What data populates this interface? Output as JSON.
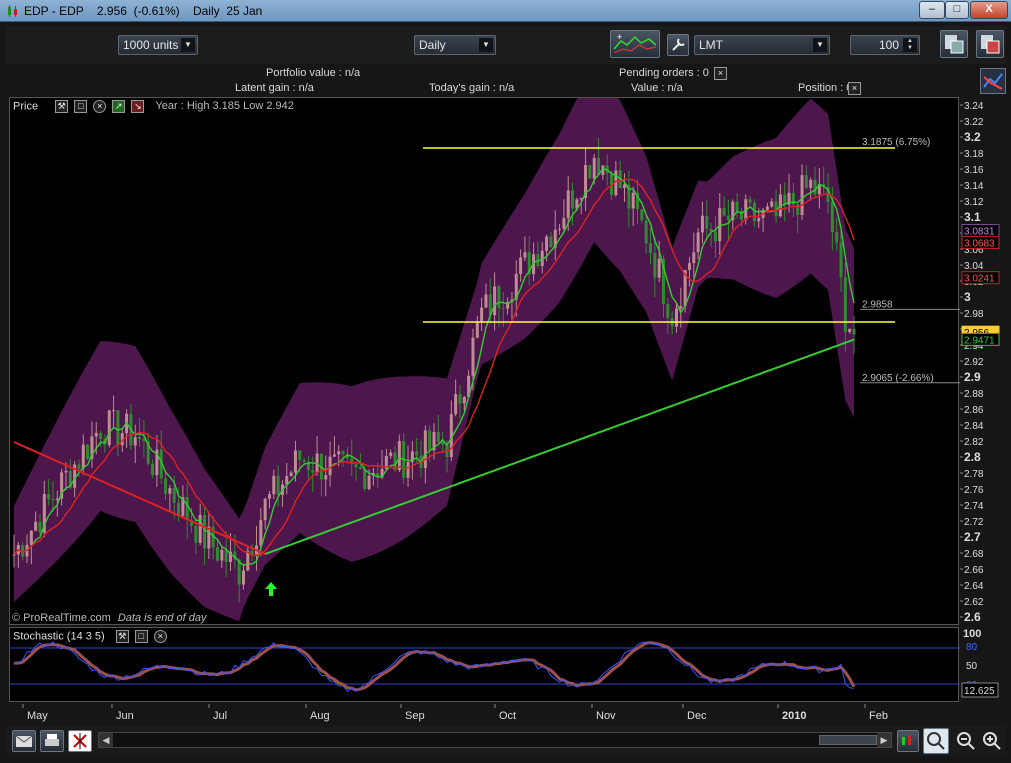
{
  "window": {
    "title": "EDP - EDP    2.956  (-0.61%)    Daily  25 Jan",
    "minimize": "–",
    "maximize": "□",
    "close": "X"
  },
  "toolbar": {
    "units_value": "1000 units",
    "timeframe_value": "Daily",
    "order_type_value": "LMT",
    "quantity_value": "100"
  },
  "info": {
    "portfolio_value": "Portfolio value : n/a",
    "pending_orders": "Pending orders : 0",
    "latent_gain": "Latent gain : n/a",
    "todays_gain": "Today's gain : n/a",
    "value": "Value : n/a",
    "position": "Position : 0"
  },
  "price_panel": {
    "label": "Price",
    "year_range": "Year : High 3.185  Low 2.942",
    "watermark": "© ProRealTime.com",
    "data_note": "Data is end of day",
    "level_upper": "3.1875 (6.75%)",
    "level_mid": "2.9858",
    "level_lower": "2.9065 (-2.66%)",
    "colors": {
      "band": "#5a1a5a",
      "yellow_line": "#ffff33",
      "ma_green": "#33cc33",
      "ma_red": "#dd2222",
      "candle_up": "#c08c94",
      "candle_down": "#2e8b2e"
    }
  },
  "price_axis": {
    "ticks": [
      "3.24",
      "3.22",
      "3.2",
      "3.18",
      "3.16",
      "3.14",
      "3.12",
      "3.1",
      "3.08",
      "3.06",
      "3.04",
      "3.02",
      "3",
      "2.98",
      "2.96",
      "2.94",
      "2.92",
      "2.9",
      "2.88",
      "2.86",
      "2.84",
      "2.82",
      "2.8",
      "2.78",
      "2.76",
      "2.74",
      "2.72",
      "2.7",
      "2.68",
      "2.66",
      "2.64",
      "2.62",
      "2.6"
    ],
    "major": [
      "3.2",
      "3.1",
      "3",
      "2.9",
      "2.8",
      "2.7",
      "2.6"
    ],
    "badge_ma1": "3.0831",
    "badge_ma2": "3.0683",
    "badge_ma3": "3.0241",
    "badge_last": "2.956",
    "badge_ma4": "2.9471"
  },
  "stoch_panel": {
    "label": "Stochastic (14 3 5)",
    "ticks": [
      "100",
      "80",
      "50",
      "20"
    ],
    "badge_value": "12.625"
  },
  "date_axis": {
    "labels": [
      "May",
      "Jun",
      "Jul",
      "Aug",
      "Sep",
      "Oct",
      "Nov",
      "Dec",
      "2010",
      "Feb"
    ]
  },
  "chart_data": {
    "type": "candlestick",
    "title": "EDP - EDP",
    "ylim": [
      2.6,
      3.24
    ],
    "x": [
      "May",
      "Jun",
      "Jul",
      "Aug",
      "Sep",
      "Oct",
      "Nov",
      "Dec",
      "2010",
      "Feb"
    ],
    "series": [
      {
        "name": "Price",
        "values": [
          2.7,
          2.84,
          2.8,
          2.65,
          2.74,
          2.8,
          2.78,
          2.82,
          2.96,
          3.1,
          3.16,
          3.08,
          2.98,
          3.09,
          3.08,
          3.1,
          3.16,
          3.08,
          2.96
        ]
      }
    ],
    "horizontal_levels": [
      3.1875,
      2.9858,
      2.9065
    ],
    "last": 2.956,
    "change_pct": -0.61
  }
}
